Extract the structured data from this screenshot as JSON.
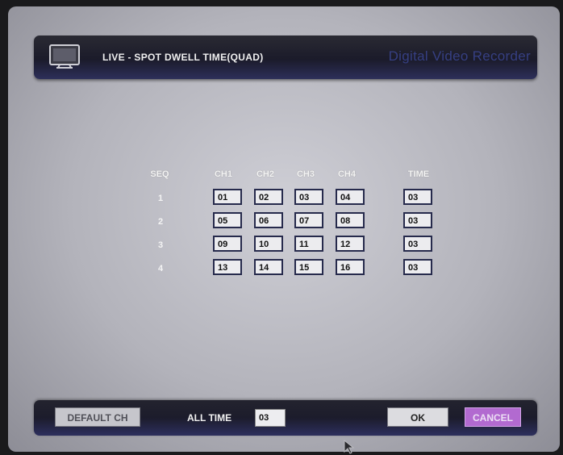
{
  "header": {
    "title": "LIVE - SPOT DWELL TIME(QUAD)",
    "brand": "Digital Video Recorder",
    "icon": "monitor-icon"
  },
  "table": {
    "headers": {
      "seq": "SEQ",
      "ch1": "CH1",
      "ch2": "CH2",
      "ch3": "CH3",
      "ch4": "CH4",
      "time": "TIME"
    },
    "rows": [
      {
        "seq": "1",
        "ch1": "01",
        "ch2": "02",
        "ch3": "03",
        "ch4": "04",
        "time": "03"
      },
      {
        "seq": "2",
        "ch1": "05",
        "ch2": "06",
        "ch3": "07",
        "ch4": "08",
        "time": "03"
      },
      {
        "seq": "3",
        "ch1": "09",
        "ch2": "10",
        "ch3": "11",
        "ch4": "12",
        "time": "03"
      },
      {
        "seq": "4",
        "ch1": "13",
        "ch2": "14",
        "ch3": "15",
        "ch4": "16",
        "time": "03"
      }
    ]
  },
  "footer": {
    "default_label": "DEFAULT CH",
    "all_time_label": "ALL TIME",
    "all_time_value": "03",
    "ok_label": "OK",
    "cancel_label": "CANCEL"
  },
  "colors": {
    "cancel_button": "#b26ad0",
    "brand_text": "#3c4898",
    "cell_border": "#262a4c"
  }
}
